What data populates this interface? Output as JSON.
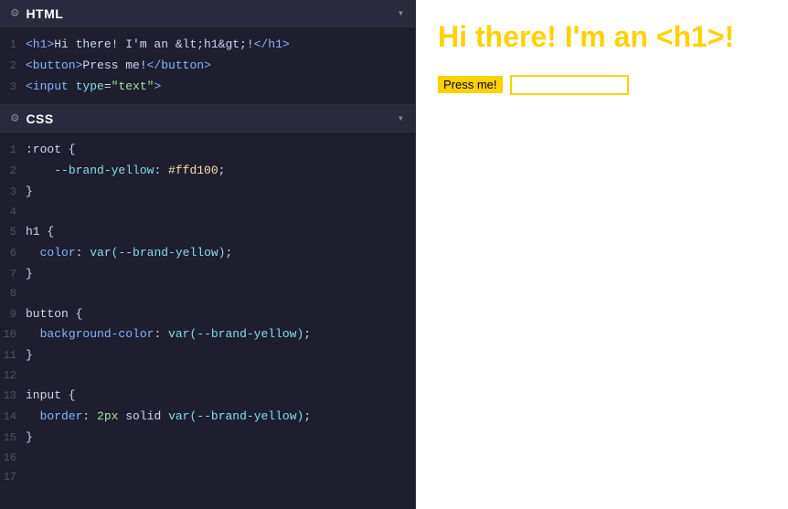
{
  "left_panel": {
    "html_section": {
      "title": "HTML",
      "gear_icon": "⚙",
      "chevron_icon": "▾",
      "lines": [
        {
          "num": "1",
          "parts": [
            {
              "type": "tag",
              "text": "<h1>"
            },
            {
              "type": "text",
              "text": "Hi there! I'm an "
            },
            {
              "type": "entity",
              "text": "&lt;h1&gt;"
            },
            {
              "type": "text",
              "text": "!"
            },
            {
              "type": "tag",
              "text": "</h1>"
            }
          ]
        },
        {
          "num": "2",
          "parts": [
            {
              "type": "tag",
              "text": "<button>"
            },
            {
              "type": "text",
              "text": "Press me!"
            },
            {
              "type": "tag",
              "text": "</button>"
            }
          ]
        },
        {
          "num": "3",
          "parts": [
            {
              "type": "tag",
              "text": "<input"
            },
            {
              "type": "space",
              "text": " "
            },
            {
              "type": "attr-name",
              "text": "type"
            },
            {
              "type": "equals",
              "text": "="
            },
            {
              "type": "attr-value",
              "text": "\"text\""
            },
            {
              "type": "tag",
              "text": ">"
            }
          ]
        }
      ]
    },
    "css_section": {
      "title": "CSS",
      "gear_icon": "⚙",
      "chevron_icon": "▾",
      "lines": [
        {
          "num": "1",
          "text": ":root {",
          "type": "selector"
        },
        {
          "num": "2",
          "text": "    --brand-yellow: #ffd100;",
          "type": "css-var"
        },
        {
          "num": "3",
          "text": "}",
          "type": "brace"
        },
        {
          "num": "4",
          "text": "",
          "type": "empty"
        },
        {
          "num": "5",
          "text": "h1 {",
          "type": "selector"
        },
        {
          "num": "6",
          "text": "  color: var(--brand-yellow);",
          "type": "property-var"
        },
        {
          "num": "7",
          "text": "}",
          "type": "brace"
        },
        {
          "num": "8",
          "text": "",
          "type": "empty"
        },
        {
          "num": "9",
          "text": "button {",
          "type": "selector"
        },
        {
          "num": "10",
          "text": "  background-color: var(--brand-yellow);",
          "type": "property-var"
        },
        {
          "num": "11",
          "text": "}",
          "type": "brace"
        },
        {
          "num": "12",
          "text": "",
          "type": "empty"
        },
        {
          "num": "13",
          "text": "input {",
          "type": "selector"
        },
        {
          "num": "14",
          "text": "  border: 2px solid var(--brand-yellow);",
          "type": "property-mixed"
        },
        {
          "num": "15",
          "text": "}",
          "type": "brace"
        },
        {
          "num": "16",
          "text": "",
          "type": "empty"
        },
        {
          "num": "17",
          "text": "",
          "type": "empty"
        }
      ]
    }
  },
  "right_panel": {
    "h1_text": "Hi there! I'm an <h1>!",
    "button_label": "Press me!",
    "input_placeholder": ""
  }
}
